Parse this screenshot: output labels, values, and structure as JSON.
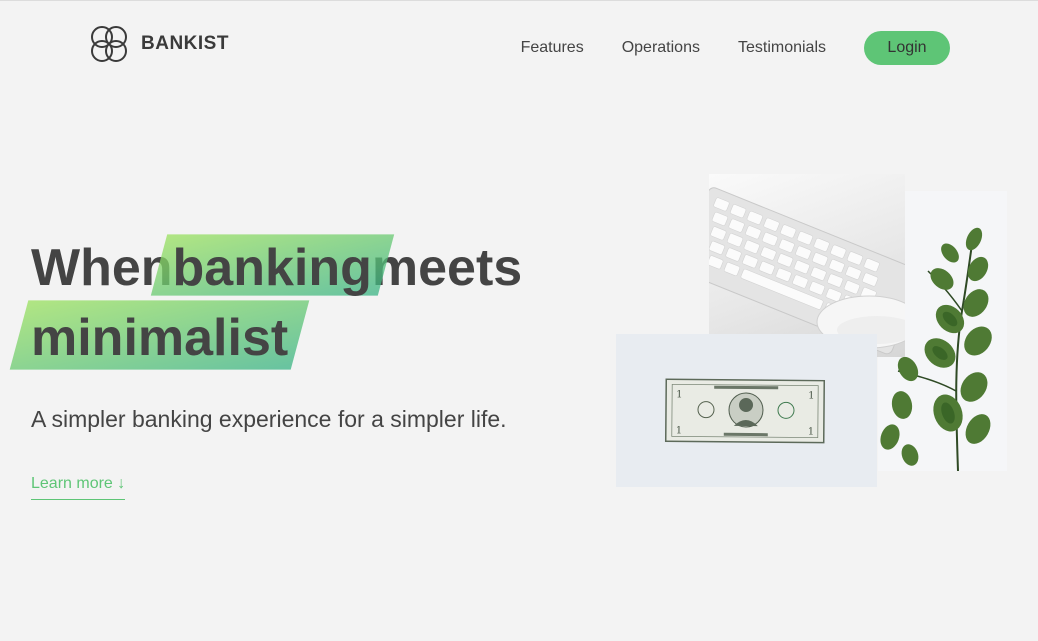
{
  "brand": {
    "name": "BANKIST"
  },
  "nav": {
    "links": [
      "Features",
      "Operations",
      "Testimonials"
    ],
    "login_label": "Login"
  },
  "hero": {
    "title_word_1": "When",
    "title_highlight_1": "banking",
    "title_word_2": "meets",
    "title_highlight_2": "minimalist",
    "subtitle": "A simpler banking experience for a simpler life.",
    "learn_more": "Learn more ↓"
  },
  "colors": {
    "accent": "#5ec576",
    "highlight_gradient_start": "#9be15d",
    "highlight_gradient_end": "#39b385",
    "background": "#f3f3f3",
    "text": "#444444"
  },
  "icons": {
    "logo": "four-circles-icon"
  }
}
